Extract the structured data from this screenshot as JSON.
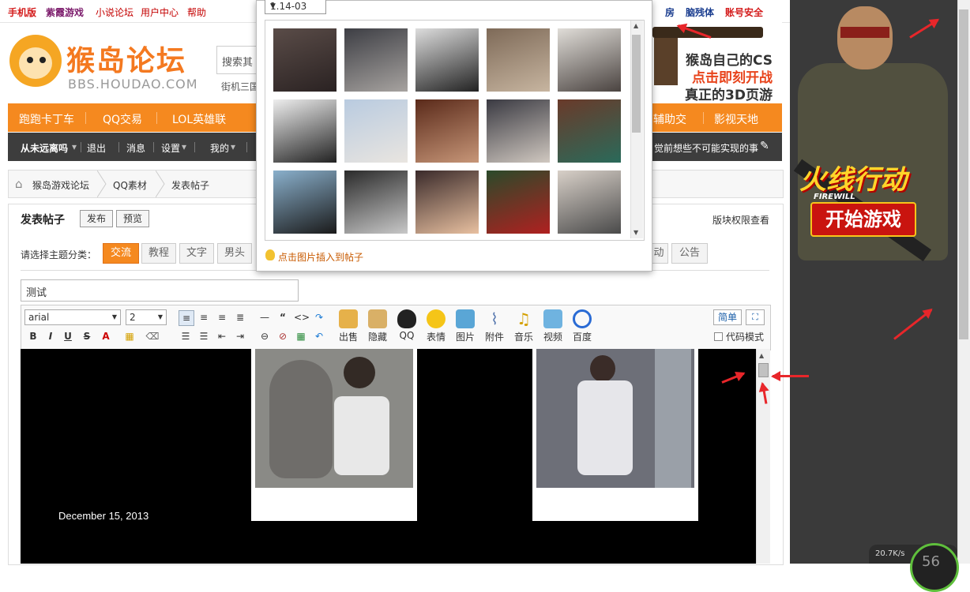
{
  "topbar": {
    "links": [
      "手机版",
      "紫霞游戏",
      "小说论坛",
      "用户中心",
      "帮助"
    ],
    "right_links": [
      "房",
      "脑残体",
      "账号安全"
    ]
  },
  "header": {
    "logo_text": "猴岛论坛",
    "logo_sub": "BBS.HOUDAO.COM",
    "search_placeholder": "搜索其",
    "hot_search": "街机三国"
  },
  "cs_banner": {
    "line1": "猴岛自己的CS",
    "line2": "点击即刻开战",
    "line3": "真正的3D页游"
  },
  "nav": {
    "items": [
      "跑跑卡丁车",
      "QQ交易",
      "LOL英雄联",
      "辅助交",
      "影视天地"
    ]
  },
  "userbar": {
    "username": "从未远离吗",
    "items": [
      "退出",
      "消息",
      "设置",
      "我的"
    ],
    "motto": "觉前想些不可能实现的事"
  },
  "breadcrumb": {
    "items": [
      "猴岛游戏论坛",
      "QQ素材",
      "发表帖子"
    ]
  },
  "post": {
    "title": "发表帖子",
    "publish_label": "发布",
    "preview_label": "预览",
    "permission_link": "版块权限查看",
    "type_label": "请选择主题分类：",
    "types": [
      "交流",
      "教程",
      "文字",
      "男头",
      "动",
      "公告"
    ],
    "subject_value": "测试"
  },
  "editor": {
    "font_family": "arial",
    "font_size": "2",
    "tools": [
      {
        "label": "出售",
        "icon": "sell-icon"
      },
      {
        "label": "隐藏",
        "icon": "hide-icon"
      },
      {
        "label": "QQ",
        "icon": "qq-penguin-icon"
      },
      {
        "label": "表情",
        "icon": "smiley-icon"
      },
      {
        "label": "图片",
        "icon": "picture-icon"
      },
      {
        "label": "附件",
        "icon": "paperclip-icon"
      },
      {
        "label": "音乐",
        "icon": "music-note-icon"
      },
      {
        "label": "视频",
        "icon": "video-icon"
      },
      {
        "label": "百度",
        "icon": "baidu-icon"
      }
    ],
    "simple_label": "简单",
    "code_mode_label": "代码模式",
    "date_text": "December 15, 2013"
  },
  "image_popup": {
    "album": "1.14-03",
    "hint": "点击图片插入到帖子"
  },
  "ad": {
    "title": "火线行动",
    "brand": "FIREWILL",
    "start_label": "开始游戏"
  },
  "netspeed": {
    "speed": "20.7K/s",
    "gauge": "56"
  },
  "colors": {
    "brand_orange": "#f5891f",
    "link_red": "#d41c1c",
    "dark_bar": "#3d3d3d",
    "annotation_red": "#e8262a"
  }
}
